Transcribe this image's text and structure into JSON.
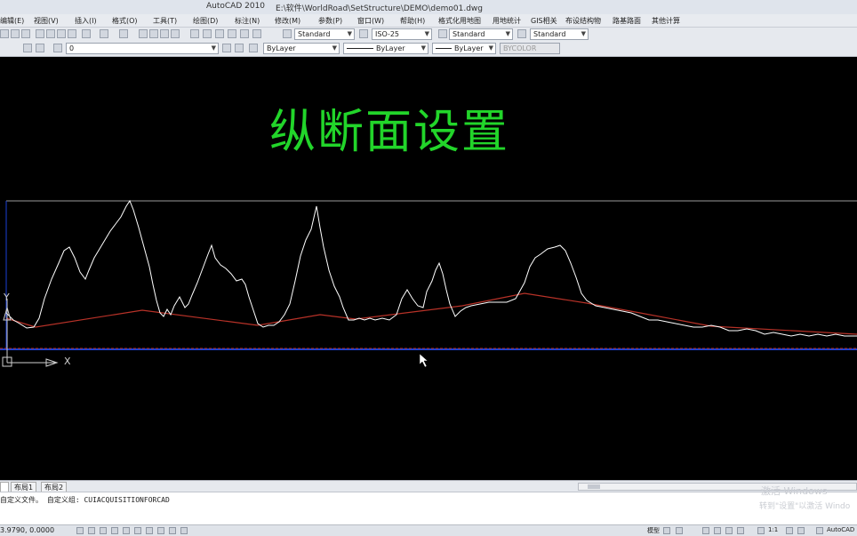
{
  "window": {
    "app_title": "AutoCAD 2010",
    "file_path": "E:\\软件\\WorldRoad\\SetStructure\\DEMO\\demo01.dwg"
  },
  "menu": [
    "编辑(E)",
    "视图(V)",
    "插入(I)",
    "格式(O)",
    "工具(T)",
    "绘图(D)",
    "标注(N)",
    "修改(M)",
    "参数(P)",
    "窗口(W)",
    "帮助(H)",
    "格式化用地图",
    "用地统计",
    "GIS相关",
    "布设结构物",
    "路基路面",
    "其他计算"
  ],
  "styles_toolbar": {
    "text_style": "Standard",
    "dim_style": "ISO-25",
    "table_style": "Standard",
    "mleader_style": "Standard"
  },
  "layers_toolbar": {
    "layer": "0",
    "color": "ByLayer",
    "linetype": "ByLayer",
    "lineweight": "ByLayer",
    "plotstyle": "BYCOLOR"
  },
  "drawing": {
    "heading": "纵断面设置",
    "y_axis_label": "Y",
    "x_axis_label": "X"
  },
  "layout_tabs": [
    "布局1",
    "布局2"
  ],
  "command_line": {
    "text": "自定义文件。 自定义组: CUIACQUISITIONFORCAD",
    "watermark_1": "激活 Windows",
    "watermark_2": "转到\"设置\"以激活 Windo"
  },
  "statusbar": {
    "coords": "3.9790, 0.0000",
    "model": "模型",
    "scale": "1:1",
    "app": "AutoCAD"
  },
  "colors": {
    "canvas": "#000000",
    "heading": "#22d52a",
    "ground_line": "#ffffff",
    "design_line": "#b83228",
    "axis": "#1a3fd6"
  }
}
